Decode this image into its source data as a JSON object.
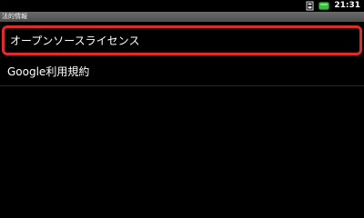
{
  "status_bar": {
    "time": "21:31",
    "icons": [
      "signal-icon",
      "battery-icon"
    ],
    "battery_color": "#39c03a"
  },
  "title_bar": {
    "title": "法的情報"
  },
  "list": {
    "items": [
      {
        "label": "オープンソースライセンス",
        "highlighted": true
      },
      {
        "label": "Google利用規約",
        "highlighted": false
      }
    ]
  },
  "colors": {
    "background": "#000000",
    "highlight": "#e02b2b",
    "text": "#ffffff"
  }
}
